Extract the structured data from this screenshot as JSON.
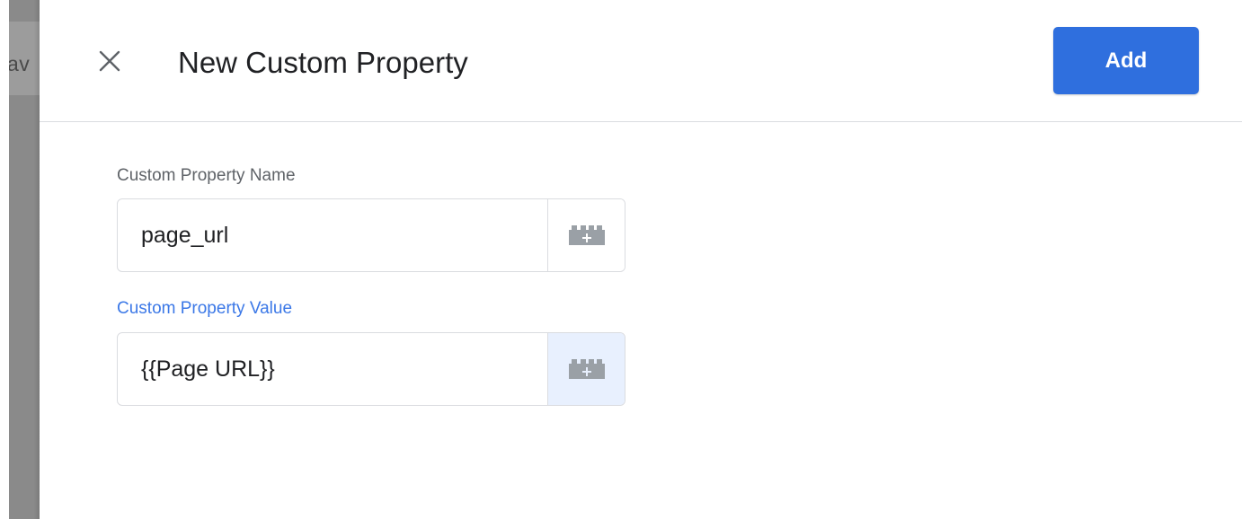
{
  "backdrop": {
    "partial_text": "av"
  },
  "dialog": {
    "title": "New Custom Property",
    "add_label": "Add",
    "close_icon": "close-icon"
  },
  "fields": {
    "name": {
      "label": "Custom Property Name",
      "value": "page_url",
      "variable_icon": "add-variable-icon"
    },
    "value": {
      "label": "Custom Property Value",
      "value": "{{Page URL}}",
      "variable_icon": "add-variable-icon"
    }
  },
  "colors": {
    "accent": "#2f6fde",
    "active_label": "#3b78e7",
    "highlight_bg": "#e8f0fe",
    "icon_gray": "#9aa0a6"
  }
}
